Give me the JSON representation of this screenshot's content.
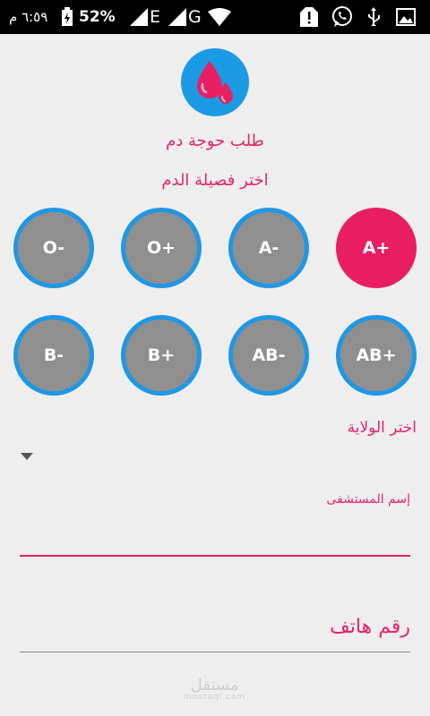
{
  "status_bar": {
    "time": "٦:٥٩ م",
    "battery": "52%",
    "network_1": "E",
    "network_2": "G"
  },
  "header": {
    "title": "طلب حوجة دم",
    "blood_type_prompt": "اختر فصيلة الدم"
  },
  "blood_types": [
    {
      "label": "A+",
      "selected": true
    },
    {
      "label": "A-",
      "selected": false
    },
    {
      "label": "O+",
      "selected": false
    },
    {
      "label": "O-",
      "selected": false
    },
    {
      "label": "AB+",
      "selected": false
    },
    {
      "label": "AB-",
      "selected": false
    },
    {
      "label": "B+",
      "selected": false
    },
    {
      "label": "B-",
      "selected": false
    }
  ],
  "state": {
    "label": "اختر الولاية"
  },
  "hospital": {
    "label": "إسم المستشفى",
    "value": ""
  },
  "phone": {
    "placeholder": "رقم هاتف"
  },
  "watermark": {
    "brand": "مستقل",
    "domain": "mostaql.com"
  },
  "colors": {
    "accent": "#e91e63",
    "ring": "#1f97e3",
    "unselected": "#8f8f8f",
    "logo_bg": "#1a9be3"
  }
}
